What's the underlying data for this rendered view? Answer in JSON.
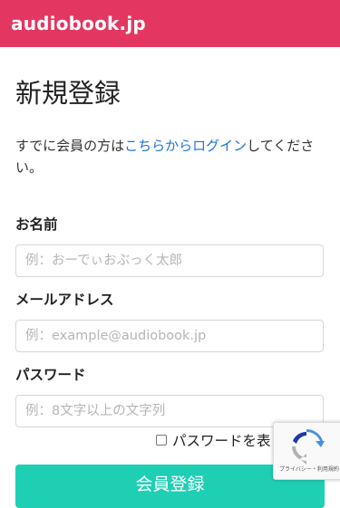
{
  "header": {
    "logo": "audiobook.jp",
    "background_color": "#e33761"
  },
  "main": {
    "title": "新規登録",
    "intro": {
      "before": "すでに会員の方は",
      "link": "こちらからログイン",
      "after": "してください。"
    },
    "form": {
      "name_label": "お名前",
      "name_placeholder": "例：おーでぃおぶっく太郎",
      "email_label": "メールアドレス",
      "email_placeholder": "例：example@audiobook.jp",
      "password_label": "パスワード",
      "password_placeholder": "例：8文字以上の文字列",
      "show_password_label": "パスワードを表",
      "submit_label": "会員登録",
      "submit_color": "#1fcfb4"
    }
  },
  "recaptcha": {
    "icon": "recaptcha-icon",
    "footer": "プライバシー・利用規約"
  }
}
